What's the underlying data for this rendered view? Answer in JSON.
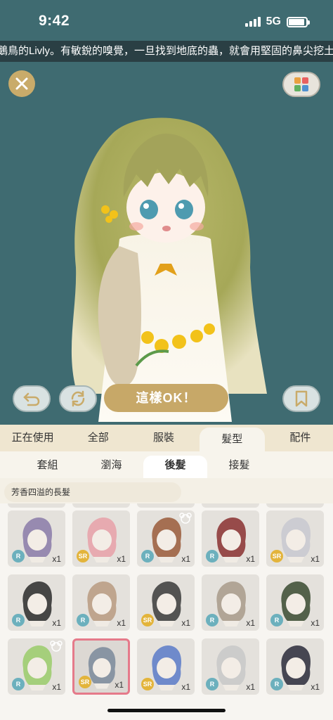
{
  "status": {
    "time": "9:42",
    "network": "5G",
    "battery_level": 0.9
  },
  "ticker": {
    "text": "鵝鳥的Livly。有敏銳的嗅覺，一旦找到地底的蟲，就會用堅固的鼻尖挖土"
  },
  "buttons": {
    "confirm_label": "這樣OK！"
  },
  "colors": {
    "background": "#3f6b71",
    "gold": "#c7a868",
    "selected_border": "#e57a8a"
  },
  "tabs": [
    "正在使用",
    "全部",
    "服裝",
    "髮型",
    "配件"
  ],
  "active_tab": "髮型",
  "subtabs": [
    "套組",
    "瀏海",
    "後髮",
    "接髮"
  ],
  "active_subtab": "後髮",
  "selected_item_name": "芳香四溢的長髮",
  "items": [
    {
      "rarity": "R",
      "qty": "x1",
      "hair": "#8a7aa8",
      "bear": false
    },
    {
      "rarity": "SR",
      "qty": "x1",
      "hair": "#e8a0a8",
      "bear": false
    },
    {
      "rarity": "R",
      "qty": "x1",
      "hair": "#9a5a3a",
      "bear": true
    },
    {
      "rarity": "R",
      "qty": "x1",
      "hair": "#8a3030",
      "bear": false
    },
    {
      "rarity": "SR",
      "qty": "x1",
      "hair": "#c8c8d0",
      "bear": false
    },
    {
      "rarity": "R",
      "qty": "x1",
      "hair": "#2a2a2a",
      "bear": false
    },
    {
      "rarity": "R",
      "qty": "x1",
      "hair": "#b89a80",
      "bear": false
    },
    {
      "rarity": "SR",
      "qty": "x1",
      "hair": "#3a3a3a",
      "bear": false
    },
    {
      "rarity": "R",
      "qty": "x1",
      "hair": "#a89a8a",
      "bear": false
    },
    {
      "rarity": "R",
      "qty": "x1",
      "hair": "#3a4a30",
      "bear": false
    },
    {
      "rarity": "R",
      "qty": "x1",
      "hair": "#9acb6a",
      "bear": true
    },
    {
      "rarity": "SR",
      "qty": "x1",
      "hair": "#7a8a9a",
      "bear": false
    },
    {
      "rarity": "SR",
      "qty": "x1",
      "hair": "#5a7ac8",
      "bear": false
    },
    {
      "rarity": "R",
      "qty": "x1",
      "hair": "#c8c8c8",
      "bear": false
    },
    {
      "rarity": "R",
      "qty": "x1",
      "hair": "#2a2a3a",
      "bear": false
    }
  ],
  "selected_item_index": 11
}
